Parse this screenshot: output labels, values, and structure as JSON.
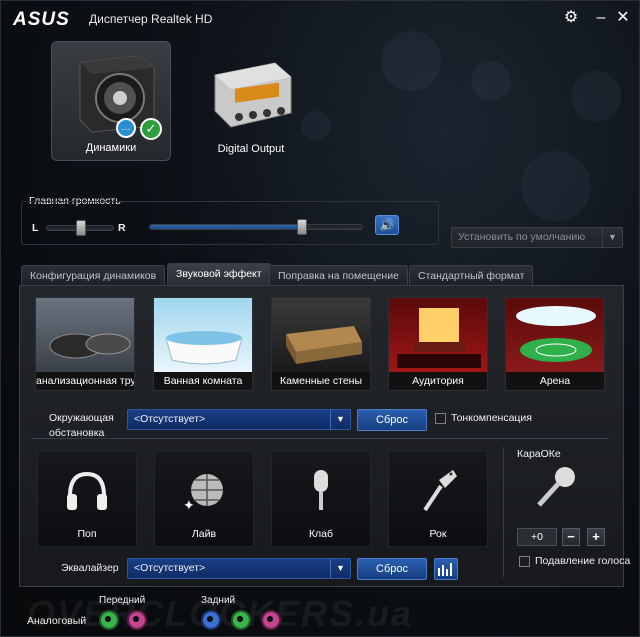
{
  "titlebar": {
    "logo": "ASUS",
    "title": "Диспетчер Realtek HD"
  },
  "devices": [
    {
      "label": "Динамики",
      "active": true
    },
    {
      "label": "Digital Output",
      "active": false
    }
  ],
  "volume": {
    "label": "Главная громкость",
    "balance_left": "L",
    "balance_right": "R",
    "level": 0.72
  },
  "default_dropdown": "Установить по умолчанию",
  "tabs": [
    {
      "label": "Конфигурация динамиков"
    },
    {
      "label": "Звуковой эффект",
      "active": true
    },
    {
      "label": "Поправка на помещение"
    },
    {
      "label": "Стандартный формат"
    }
  ],
  "environments": [
    {
      "label": "анализационная труб"
    },
    {
      "label": "Ванная комната"
    },
    {
      "label": "Каменные стены"
    },
    {
      "label": "Аудитория"
    },
    {
      "label": "Арена"
    }
  ],
  "environment": {
    "label_line1": "Окружающая",
    "label_line2": "обстановка",
    "value": "<Отсутствует>",
    "reset": "Сброс",
    "loudness_label": "Тонкомпенсация"
  },
  "genres": [
    {
      "label": "Поп",
      "icon": "headphones-icon"
    },
    {
      "label": "Лайв",
      "icon": "disco-ball-icon"
    },
    {
      "label": "Клаб",
      "icon": "microphone-icon"
    },
    {
      "label": "Рок",
      "icon": "guitar-icon"
    }
  ],
  "karaoke": {
    "title": "КараОКе",
    "value": "+0",
    "minus": "−",
    "plus": "+",
    "suppress_label": "Подавление голоса"
  },
  "equalizer": {
    "label": "Эквалайзер",
    "value": "<Отсутствует>",
    "reset": "Сброс"
  },
  "jacks": {
    "analog_label": "Аналоговый",
    "front_label": "Передний",
    "rear_label": "Задний"
  },
  "watermark": "OVERCLOCKERS.ua",
  "colors": {
    "accent": "#1e4a8a",
    "check_green": "#2e9e3a",
    "jack_green": "#3bb24a",
    "jack_pink": "#c2458e",
    "jack_blue": "#3b6fd0"
  }
}
